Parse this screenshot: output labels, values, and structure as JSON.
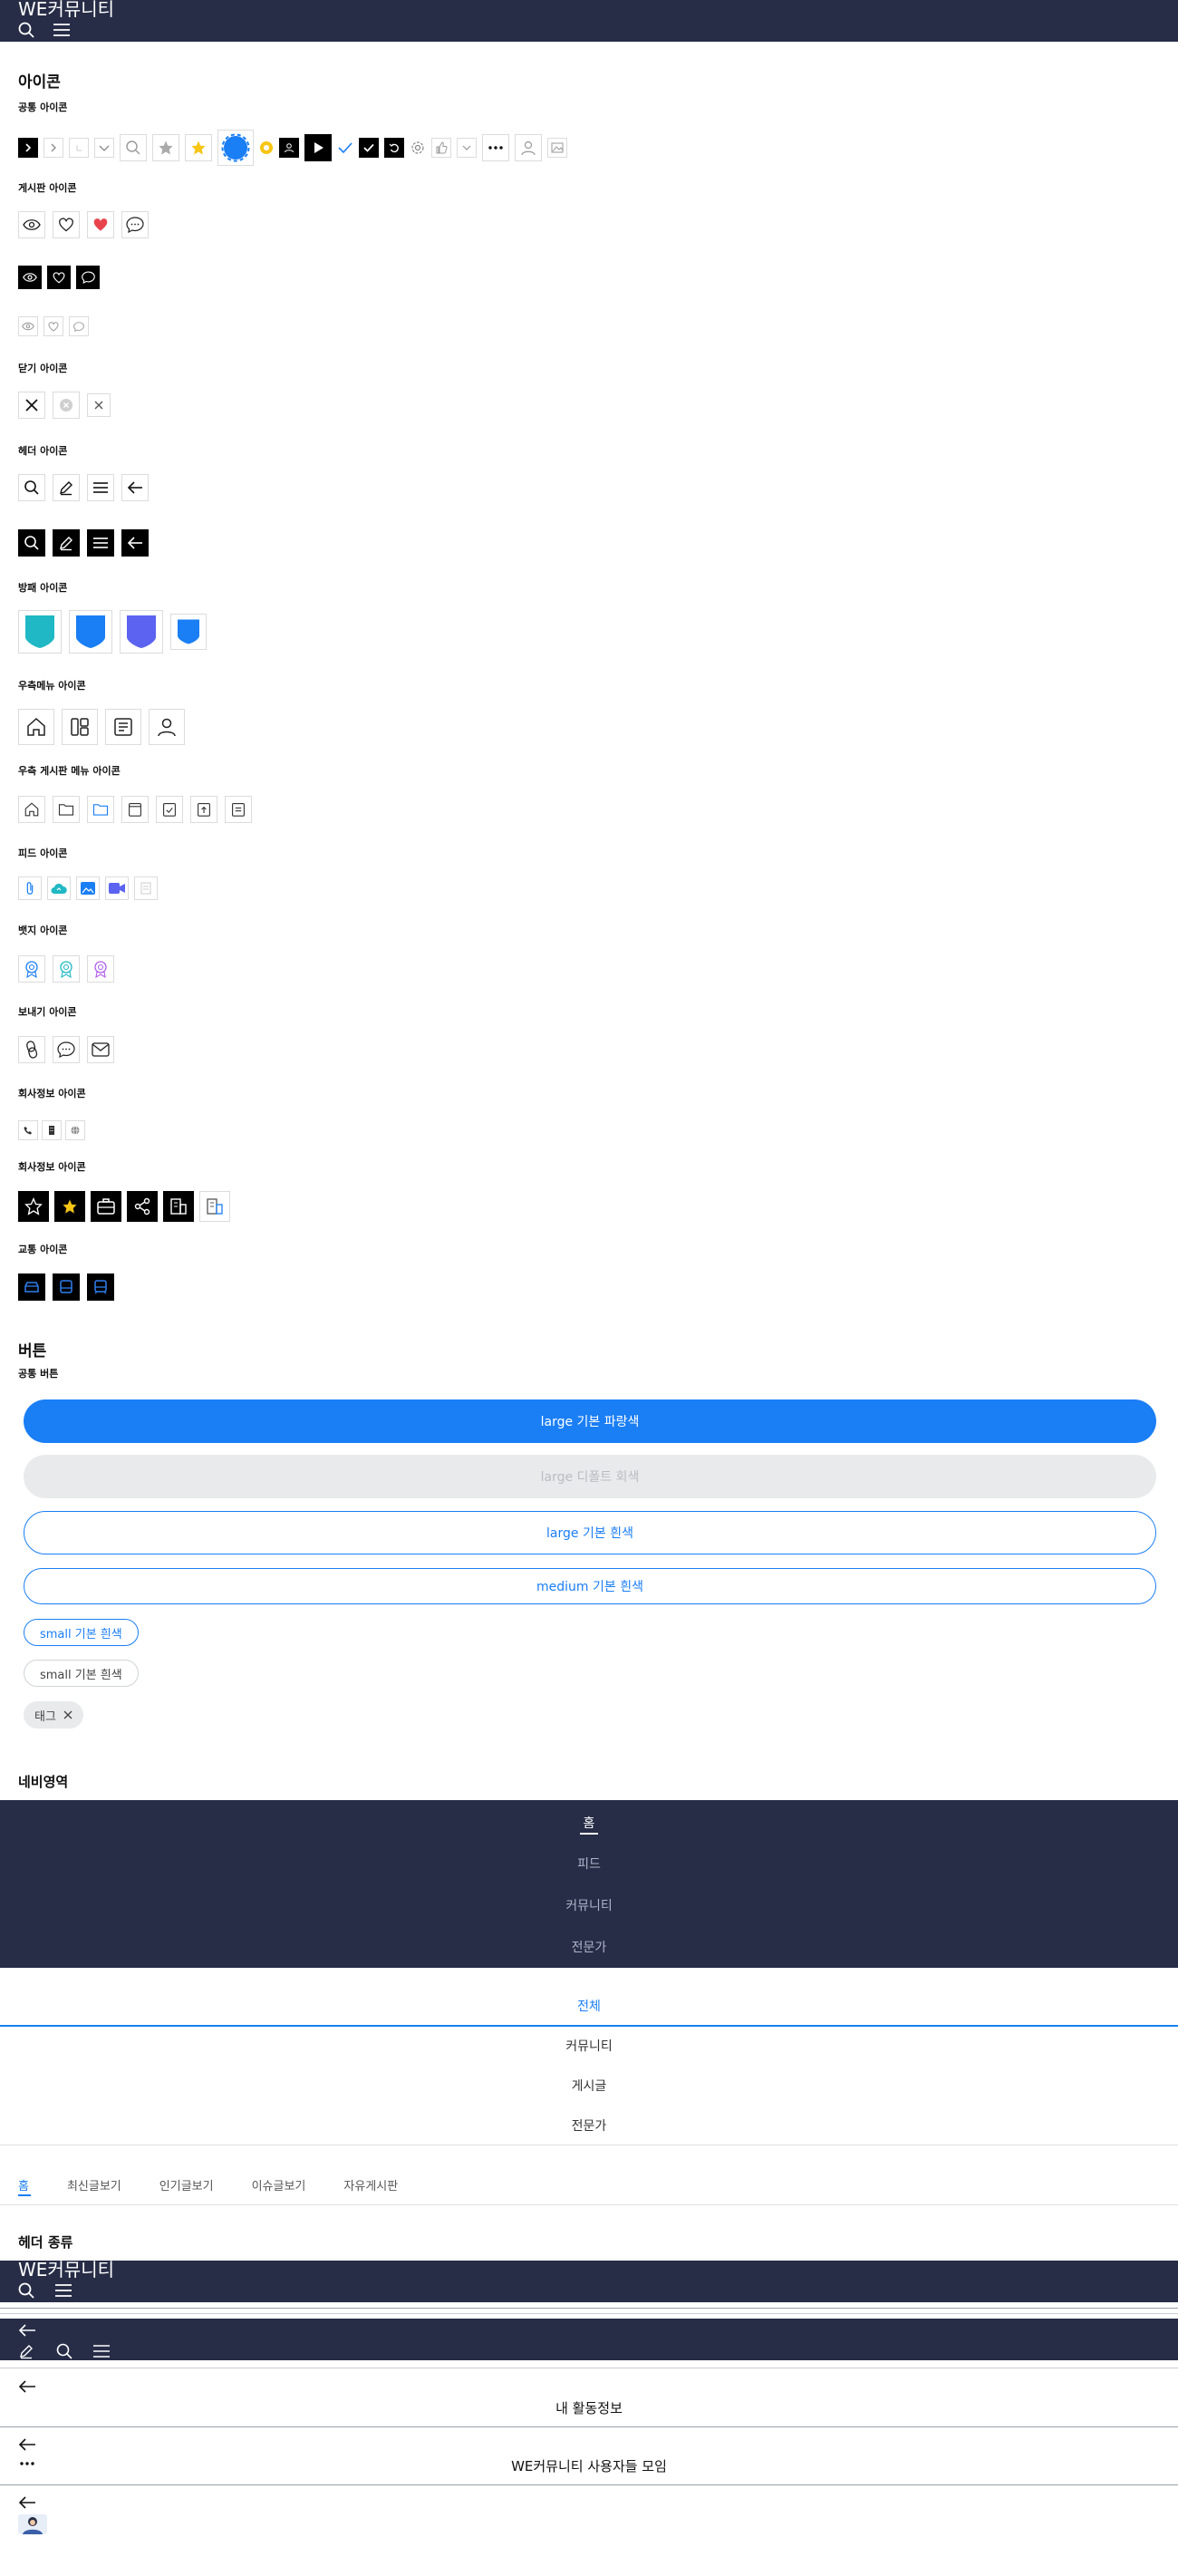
{
  "app_title": "WE커뮤니티",
  "sections": {
    "icons": "아이콘",
    "common_icons": "공통 아이콘",
    "board_icons": "게시판 아이콘",
    "close_icons": "닫기 아이콘",
    "header_icons": "헤더 아이콘",
    "shield_icons": "방패 아이콘",
    "right_menu_icons": "우측메뉴 아이콘",
    "right_board_menu_icons": "우측 게시판 메뉴 아이콘",
    "feed_icons": "피드 아이콘",
    "badge_icons": "뱃지 아이콘",
    "send_icons": "보내기 아이콘",
    "company_icons_1": "회사정보 아이콘",
    "company_icons_2": "회사정보 아이콘",
    "transport_icons": "교통 아이콘",
    "buttons": "버튼",
    "common_buttons": "공통 버튼",
    "nav_area": "네비영역",
    "header_types": "헤더 종류"
  },
  "buttons": {
    "large_blue": "large 기본 파랑색",
    "large_disabled": "large 디폴트 회색",
    "large_white": "large 기본 흰색",
    "medium_white": "medium 기본 흰색",
    "small_white_blue": "small 기본 흰색",
    "small_white_gray": "small 기본 흰색",
    "tag": "태그"
  },
  "gnb_dark": {
    "items": [
      "홈",
      "피드",
      "커뮤니티",
      "전문가"
    ],
    "active_index": 0
  },
  "gnb_light": {
    "items": [
      "전체",
      "커뮤니티",
      "게시글",
      "전문가"
    ],
    "active_index": 0
  },
  "tabs": {
    "items": [
      "홈",
      "최신글보기",
      "인기글보기",
      "이슈글보기",
      "자유게시판"
    ],
    "active_index": 0
  },
  "headers": {
    "title_my_activity": "내 활동정보",
    "title_group": "WE커뮤니티 사용자들 모임"
  },
  "colors": {
    "navy": "#272d47",
    "primary": "#1a7ef5",
    "disabled_bg": "#e9eaec",
    "heart_red": "#e8434d",
    "star_yellow": "#f7c514",
    "teal": "#1fb8c4",
    "indigo": "#5b63f0"
  }
}
